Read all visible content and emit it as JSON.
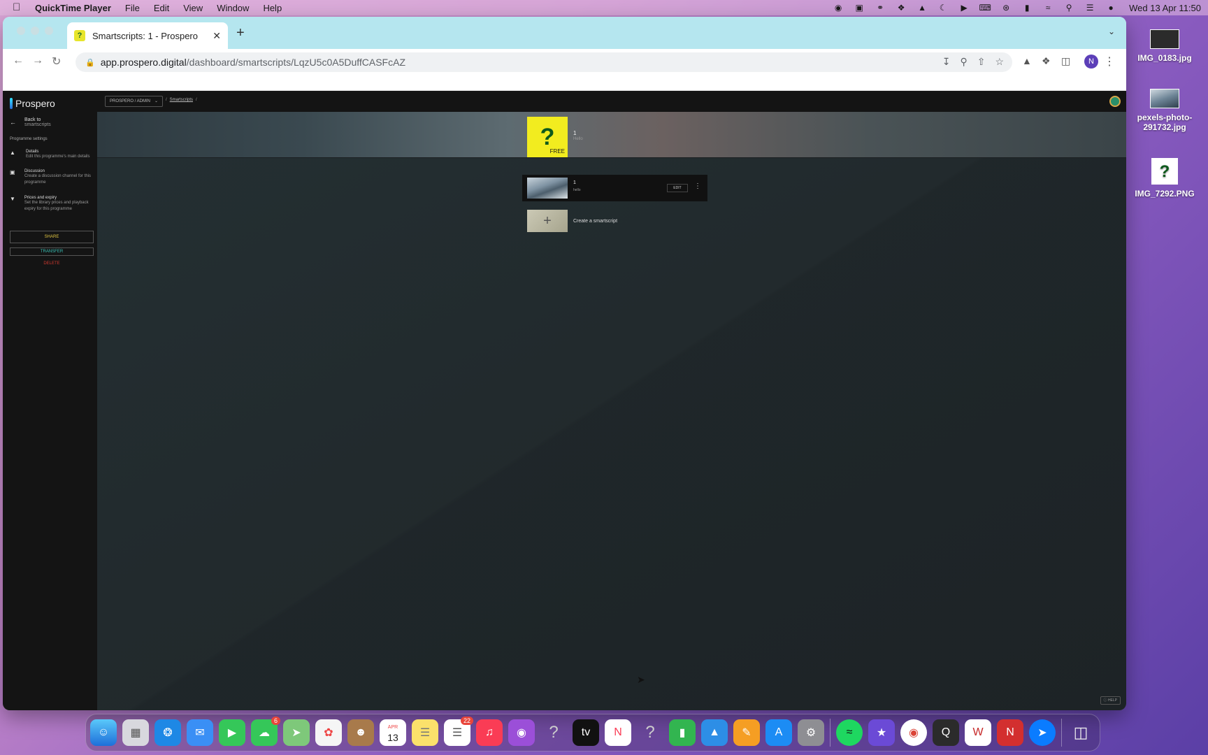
{
  "menubar": {
    "app_name": "QuickTime Player",
    "items": [
      "File",
      "Edit",
      "View",
      "Window",
      "Help"
    ],
    "clock": "Wed 13 Apr  11:50"
  },
  "browser": {
    "tab_title": "Smartscripts: 1 - Prospero",
    "url_host": "app.prospero.digital",
    "url_path": "/dashboard/smartscripts/LqzU5c0A5DuffCASFcAZ",
    "profile_initial": "N"
  },
  "sidebar": {
    "logo": "Prospero",
    "back_label": "Back to",
    "back_sub": "smartscripts",
    "heading": "Programme settings",
    "items": [
      {
        "title": "Details",
        "desc": "Edit this programme's main details"
      },
      {
        "title": "Discussion",
        "desc": "Create a discussion channel for this programme"
      },
      {
        "title": "Prices and expiry",
        "desc": "Set the library prices and playback expiry for this programme"
      }
    ],
    "share": "SHARE",
    "transfer": "TRANSFER",
    "delete": "DELETE"
  },
  "topbar": {
    "org": "PROSPERO  /  ADMIN",
    "breadcrumb_sep": "/",
    "breadcrumb_link": "Smartscripts",
    "breadcrumb_end": "/"
  },
  "programme": {
    "cover_badge": "FREE",
    "title": "1",
    "desc": "Hello"
  },
  "smartscript": {
    "title": "1",
    "desc": "hello",
    "edit": "EDIT"
  },
  "create": {
    "label": "Create a smartscript"
  },
  "help": "HELP",
  "desktop": [
    {
      "label": "IMG_0183.jpg"
    },
    {
      "label": "pexels-photo-291732.jpg"
    },
    {
      "label": "IMG_7292.PNG"
    }
  ],
  "dock": {
    "messages_badge": "6",
    "calendar_month": "APR",
    "calendar_day": "13",
    "reminders_badge": "22"
  }
}
